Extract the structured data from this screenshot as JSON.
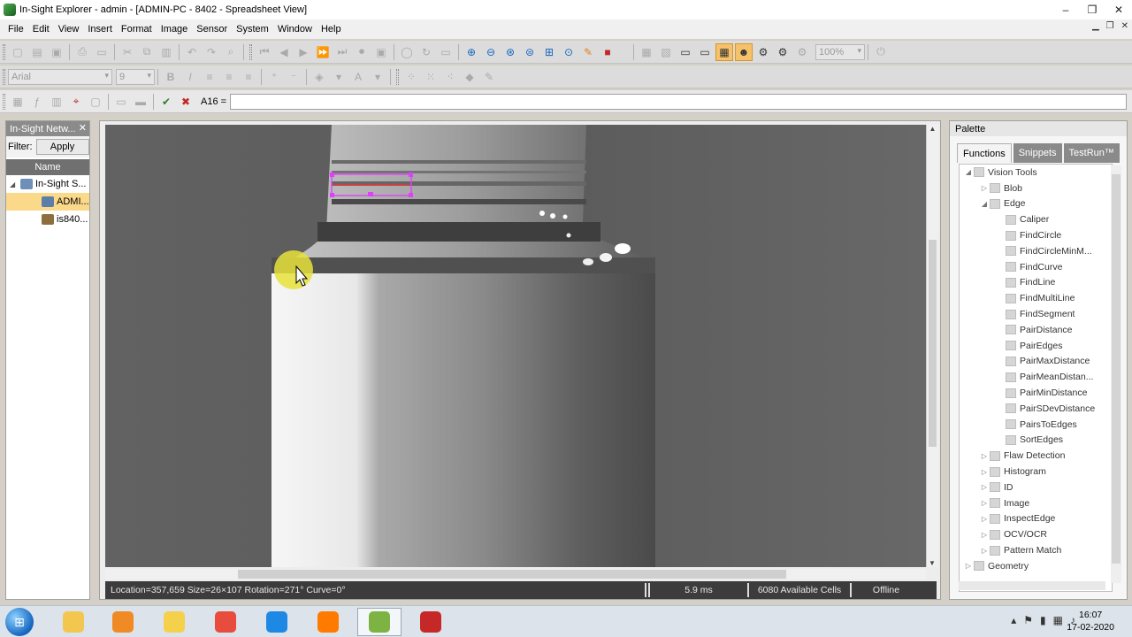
{
  "window": {
    "title": "In-Sight Explorer - admin - [ADMIN-PC - 8402 - Spreadsheet View]",
    "controls": [
      "–",
      "❐",
      "✕"
    ]
  },
  "menu": [
    "File",
    "Edit",
    "View",
    "Insert",
    "Format",
    "Image",
    "Sensor",
    "System",
    "Window",
    "Help"
  ],
  "toolbar": {
    "font_name": "Arial",
    "font_size": "9",
    "zoom": "100%",
    "cell_ref": "A16 ="
  },
  "left_panel": {
    "title": "In-Sight Netw...",
    "filter_label": "Filter:",
    "apply_label": "Apply",
    "column_header": "Name",
    "items": [
      {
        "label": "In-Sight S...",
        "indent": 0
      },
      {
        "label": "ADMI...",
        "indent": 1
      },
      {
        "label": "is840...",
        "indent": 1
      }
    ]
  },
  "image_view": {
    "status": {
      "location": "Location=357,659 Size=26×107 Rotation=271° Curve=0°",
      "time": "5.9 ms",
      "cells": "6080 Available Cells",
      "mode": "Offline"
    }
  },
  "palette": {
    "title": "Palette",
    "tabs": [
      "Functions",
      "Snippets",
      "TestRun™"
    ],
    "tree": [
      {
        "label": "Vision Tools",
        "level": 0,
        "arrow": "◢"
      },
      {
        "label": "Blob",
        "level": 1,
        "arrow": "▷"
      },
      {
        "label": "Edge",
        "level": 1,
        "arrow": "◢"
      },
      {
        "label": "Caliper",
        "level": 2,
        "arrow": ""
      },
      {
        "label": "FindCircle",
        "level": 2,
        "arrow": ""
      },
      {
        "label": "FindCircleMinM...",
        "level": 2,
        "arrow": ""
      },
      {
        "label": "FindCurve",
        "level": 2,
        "arrow": ""
      },
      {
        "label": "FindLine",
        "level": 2,
        "arrow": ""
      },
      {
        "label": "FindMultiLine",
        "level": 2,
        "arrow": ""
      },
      {
        "label": "FindSegment",
        "level": 2,
        "arrow": ""
      },
      {
        "label": "PairDistance",
        "level": 2,
        "arrow": ""
      },
      {
        "label": "PairEdges",
        "level": 2,
        "arrow": ""
      },
      {
        "label": "PairMaxDistance",
        "level": 2,
        "arrow": ""
      },
      {
        "label": "PairMeanDistan...",
        "level": 2,
        "arrow": ""
      },
      {
        "label": "PairMinDistance",
        "level": 2,
        "arrow": ""
      },
      {
        "label": "PairSDevDistance",
        "level": 2,
        "arrow": ""
      },
      {
        "label": "PairsToEdges",
        "level": 2,
        "arrow": ""
      },
      {
        "label": "SortEdges",
        "level": 2,
        "arrow": ""
      },
      {
        "label": "Flaw Detection",
        "level": 1,
        "arrow": "▷"
      },
      {
        "label": "Histogram",
        "level": 1,
        "arrow": "▷"
      },
      {
        "label": "ID",
        "level": 1,
        "arrow": "▷"
      },
      {
        "label": "Image",
        "level": 1,
        "arrow": "▷"
      },
      {
        "label": "InspectEdge",
        "level": 1,
        "arrow": "▷"
      },
      {
        "label": "OCV/OCR",
        "level": 1,
        "arrow": "▷"
      },
      {
        "label": "Pattern Match",
        "level": 1,
        "arrow": "▷"
      },
      {
        "label": "Geometry",
        "level": 0,
        "arrow": "▷"
      }
    ]
  },
  "taskbar": {
    "time": "16:07",
    "date": "17-02-2020",
    "apps": [
      {
        "name": "explorer-icon",
        "color": "#f3c64f"
      },
      {
        "name": "media-player-icon",
        "color": "#f08a24"
      },
      {
        "name": "outlook-icon",
        "color": "#f5d04a"
      },
      {
        "name": "snipping-tool-icon",
        "color": "#e74c3c"
      },
      {
        "name": "app-blue-icon",
        "color": "#1e88e5"
      },
      {
        "name": "firefox-icon",
        "color": "#ff7a00"
      },
      {
        "name": "insight-explorer-icon",
        "color": "#7cb342"
      },
      {
        "name": "red-circle-app-icon",
        "color": "#c62828"
      }
    ]
  }
}
